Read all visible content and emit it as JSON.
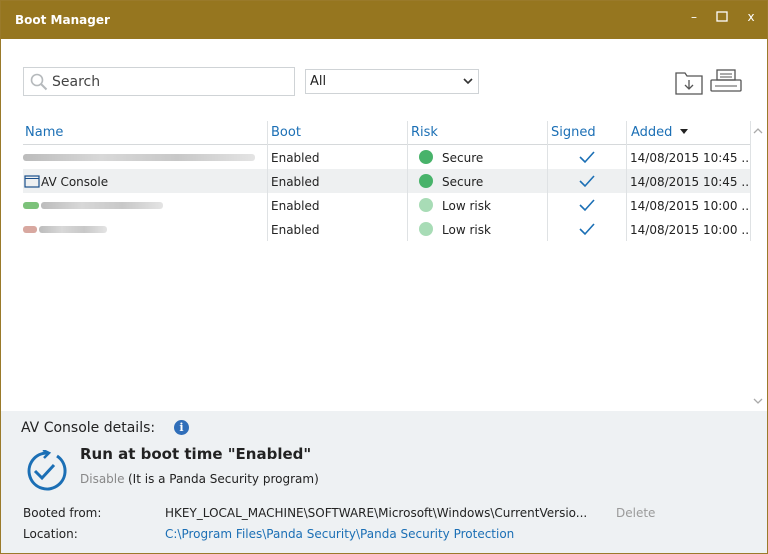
{
  "window": {
    "title": "Boot Manager",
    "controls": {
      "minimize": "–",
      "close": "x"
    }
  },
  "search": {
    "placeholder": "Search"
  },
  "filter": {
    "selected": "All"
  },
  "table": {
    "headers": {
      "name": "Name",
      "boot": "Boot",
      "risk": "Risk",
      "signed": "Signed",
      "added": "Added"
    },
    "rows": [
      {
        "name": "",
        "boot": "Enabled",
        "risk": "Secure",
        "added": "14/08/2015 10:45 ..."
      },
      {
        "name": "AV Console",
        "boot": "Enabled",
        "risk": "Secure",
        "added": "14/08/2015 10:45 ..."
      },
      {
        "name": "",
        "boot": "Enabled",
        "risk": "Low risk",
        "added": "14/08/2015 10:00 ..."
      },
      {
        "name": "",
        "boot": "Enabled",
        "risk": "Low risk",
        "added": "14/08/2015 10:00 ..."
      }
    ]
  },
  "details": {
    "heading": "AV Console details:",
    "info_glyph": "i",
    "status_title": "Run at boot time \"Enabled\"",
    "disable_link": "Disable",
    "disable_note": "(It is a Panda Security program)",
    "booted_from_label": "Booted from:",
    "booted_from_value": "HKEY_LOCAL_MACHINE\\SOFTWARE\\Microsoft\\Windows\\CurrentVersio...",
    "delete_link": "Delete",
    "location_label": "Location:",
    "location_value": "C:\\Program Files\\Panda Security\\Panda Security Protection"
  },
  "colors": {
    "titlebar": "#96761f",
    "link": "#1b6fb5",
    "secure": "#48b36a",
    "low_risk": "#a8dcb6",
    "check": "#1b6fb5"
  }
}
